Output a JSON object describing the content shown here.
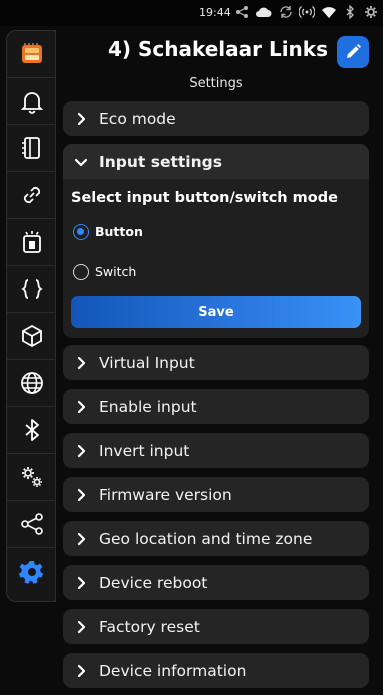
{
  "status_bar": {
    "time": "19:44",
    "icons": [
      "share-icon",
      "cloud-icon",
      "sync-icon",
      "hotspot-icon",
      "wifi-icon",
      "bluetooth-icon",
      "settings-icon"
    ]
  },
  "sidebar": {
    "items": [
      {
        "name": "device-icon",
        "active": false
      },
      {
        "name": "bell-icon",
        "active": false
      },
      {
        "name": "panel-icon",
        "active": false
      },
      {
        "name": "link-icon",
        "active": false
      },
      {
        "name": "input-icon",
        "active": false
      },
      {
        "name": "code-braces-icon",
        "active": false
      },
      {
        "name": "cube-icon",
        "active": false
      },
      {
        "name": "globe-icon",
        "active": false
      },
      {
        "name": "bluetooth-icon",
        "active": false
      },
      {
        "name": "gears-icon",
        "active": false
      },
      {
        "name": "share-nodes-icon",
        "active": false
      },
      {
        "name": "settings-gear-icon",
        "active": true
      }
    ]
  },
  "header": {
    "title": "4) Schakelaar Links",
    "subtitle": "Settings",
    "edit_icon": "pencil-icon"
  },
  "sections": {
    "eco_mode": "Eco mode",
    "input_settings": {
      "label": "Input settings",
      "question": "Select input button/switch mode",
      "options": [
        {
          "label": "Button",
          "checked": true
        },
        {
          "label": "Switch",
          "checked": false
        }
      ],
      "save_label": "Save"
    },
    "after": [
      "Virtual Input",
      "Enable input",
      "Invert input",
      "Firmware version",
      "Geo location and time zone",
      "Device reboot",
      "Factory reset",
      "Device information"
    ]
  },
  "colors": {
    "accent": "#2f86ff",
    "edit_button": "#1f6fe0",
    "row_background": "#252525",
    "page_background": "#0b0b0b"
  }
}
